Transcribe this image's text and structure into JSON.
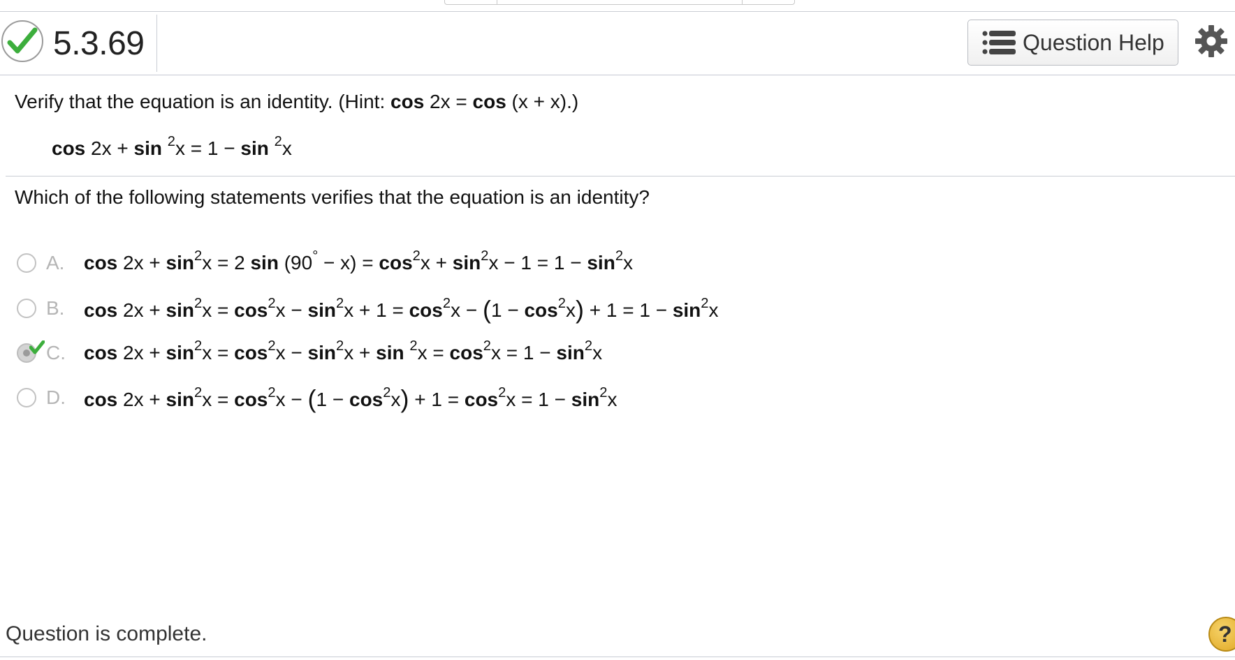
{
  "header": {
    "question_number": "5.3.69",
    "help_button_label": "Question Help",
    "status_icon": "check-icon",
    "settings_icon": "gear-icon"
  },
  "problem": {
    "instruction": {
      "before": "Verify that the equation is an identity. (Hint: ",
      "cos1": "cos",
      "mid1": " 2x = ",
      "cos2": "cos",
      "after": " (x + x).)"
    },
    "equation": {
      "cos": "cos",
      "t1": " 2x + ",
      "sin1": "sin",
      "exp1": "2",
      "t2": "x = 1 − ",
      "sin2": "sin",
      "exp2": "2",
      "t3": "x"
    },
    "question": "Which of the following statements verifies that the equation is an identity?"
  },
  "options": [
    {
      "letter": "A.",
      "selected": false
    },
    {
      "letter": "B.",
      "selected": false
    },
    {
      "letter": "C.",
      "selected": true,
      "correct": true
    },
    {
      "letter": "D.",
      "selected": false
    }
  ],
  "option_text": {
    "a": {
      "cos": "cos",
      "t1": " 2x + ",
      "sin": "sin",
      "e": "2",
      "t2": "x = 2 ",
      "sin2": "sin",
      "t3": " (90",
      "deg": "°",
      "t4": " − x) = ",
      "cos2": "cos",
      "t5": "x + ",
      "sin3": "sin",
      "t6": "x − 1 = 1 − ",
      "sin4": "sin",
      "t7": "x"
    },
    "b": {
      "cos": "cos",
      "t1": " 2x + ",
      "sin": "sin",
      "e": "2",
      "t2": "x = ",
      "cos2": "cos",
      "t3": "x − ",
      "sin2": "sin",
      "t4": "x + 1 = ",
      "cos3": "cos",
      "t5": "x − ",
      "lp": "(",
      "t6": "1 − ",
      "cos4": "cos",
      "t7": "x",
      "rp": ")",
      "t8": " + 1 = 1 − ",
      "sin3": "sin",
      "t9": "x"
    },
    "c": {
      "cos": "cos",
      "t1": " 2x + ",
      "sin": "sin",
      "e": "2",
      "t2": "x = ",
      "cos2": "cos",
      "t3": "x − ",
      "sin2": "sin",
      "t4": "x + ",
      "sin3": "sin",
      "t5": "x = ",
      "cos3": "cos",
      "t6": "x = 1 − ",
      "sin4": "sin",
      "t7": "x"
    },
    "d": {
      "cos": "cos",
      "t1": " 2x + ",
      "sin": "sin",
      "e": "2",
      "t2": "x = ",
      "cos2": "cos",
      "t3": "x − ",
      "lp": "(",
      "t4": "1 − ",
      "cos3": "cos",
      "t5": "x",
      "rp": ")",
      "t6": " + 1 = ",
      "cos4": "cos",
      "t7": "x = 1 − ",
      "sin2": "sin",
      "t8": "x"
    }
  },
  "footer": {
    "status": "Question is complete.",
    "help_symbol": "?"
  },
  "colors": {
    "check_green": "#3cae3c",
    "border_gray": "#c9cdd4",
    "help_yellow": "#e8b830"
  }
}
